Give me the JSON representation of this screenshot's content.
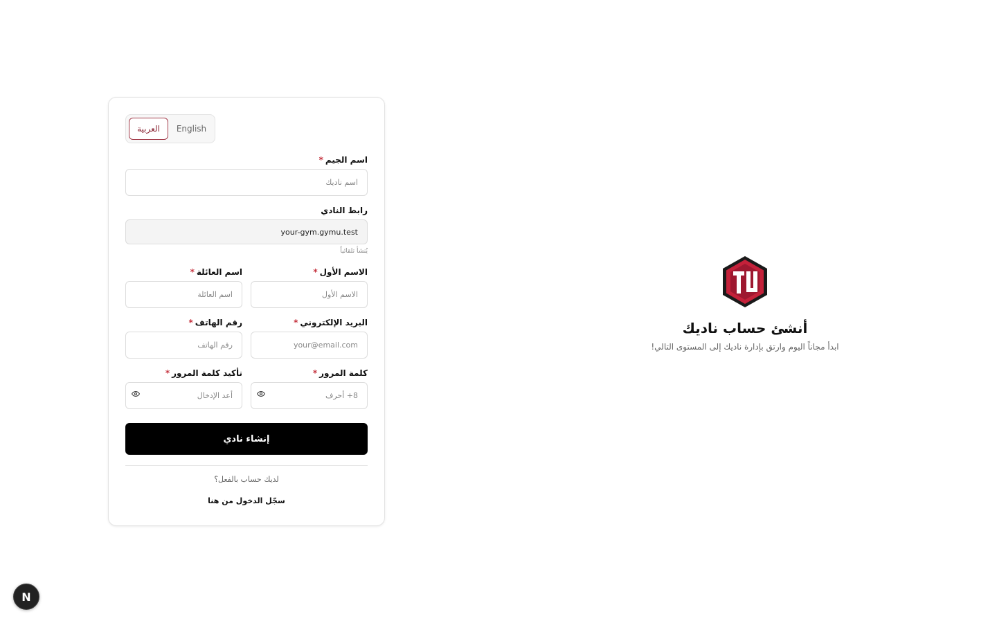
{
  "language_toggle": {
    "arabic": "العربية",
    "english": "English"
  },
  "form": {
    "gym_name": {
      "label": "اسم الجيم",
      "placeholder": "اسم ناديك"
    },
    "club_link": {
      "label": "رابط النادي",
      "value": "your-gym.gymu.test",
      "hint": "يُنشأ تلقائياً"
    },
    "first_name": {
      "label": "الاسم الأول",
      "placeholder": "الاسم الأول"
    },
    "last_name": {
      "label": "اسم العائلة",
      "placeholder": "اسم العائلة"
    },
    "email": {
      "label": "البريد الإلكتروني",
      "placeholder": "your@email.com"
    },
    "phone": {
      "label": "رقم الهاتف",
      "placeholder": "رقم الهاتف"
    },
    "password": {
      "label": "كلمة المرور",
      "placeholder": "8+ أحرف"
    },
    "confirm_password": {
      "label": "تأكيد كلمة المرور",
      "placeholder": "أعد الإدخال"
    },
    "required_mark": "*",
    "submit_label": "إنشاء نادي",
    "have_account": "لديك حساب بالفعل؟",
    "login_link": "سجّل الدخول من هنا"
  },
  "hero": {
    "title": "أنشئ حساب ناديك",
    "subtitle": "ابدأ مجاناً اليوم وارتق بإدارة ناديك إلى المستوى التالي!"
  },
  "next_badge": "N",
  "colors": {
    "accent": "#a33b4a",
    "logo_red": "#c4213a",
    "button": "#000000"
  }
}
